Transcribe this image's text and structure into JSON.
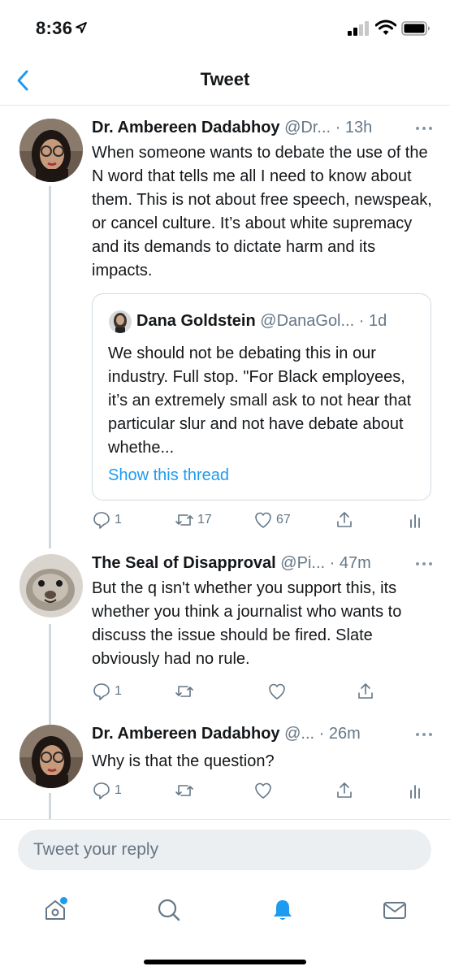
{
  "status_bar": {
    "time": "8:36"
  },
  "nav": {
    "title": "Tweet"
  },
  "tweets": [
    {
      "author": "Dr. Ambereen Dadabhoy",
      "handle": "@Dr...",
      "time": "· 13h",
      "text": "When someone wants to debate the use of the N word that tells me all I need to know about them. This is not about free speech, newspeak, or cancel culture. It’s about white supremacy and its demands to dictate harm and its impacts.",
      "quote": {
        "author": "Dana Goldstein",
        "handle": "@DanaGol...",
        "time": "· 1d",
        "text": "We should not be debating this in our industry. Full stop. \"For Black employees, it’s an extremely small ask to not hear that particular slur and not have debate about whethe...",
        "show_thread": "Show this thread"
      },
      "replies": "1",
      "retweets": "17",
      "likes": "67"
    },
    {
      "author": "The Seal of Disapproval",
      "handle": "@Pi...",
      "time": "· 47m",
      "text": "But the q isn't whether you support this, its whether you think a journalist who wants to discuss the issue should be fired. Slate obviously had no rule.",
      "replies": "1"
    },
    {
      "author": "Dr. Ambereen Dadabhoy",
      "handle": "@...",
      "time": "· 26m",
      "text": "Why is that the question?",
      "replies": "1"
    }
  ],
  "reply": {
    "placeholder": "Tweet your reply"
  },
  "colors": {
    "accent": "#1d9bf0",
    "secondary_text": "#657786",
    "thread_line": "#cfd9de"
  },
  "icons": [
    "location-arrow-icon",
    "signal-icon",
    "wifi-icon",
    "battery-icon",
    "back-chevron-icon",
    "more-icon",
    "reply-icon",
    "retweet-icon",
    "like-icon",
    "share-icon",
    "analytics-icon",
    "home-icon",
    "search-icon",
    "notifications-bell-icon",
    "messages-icon"
  ]
}
